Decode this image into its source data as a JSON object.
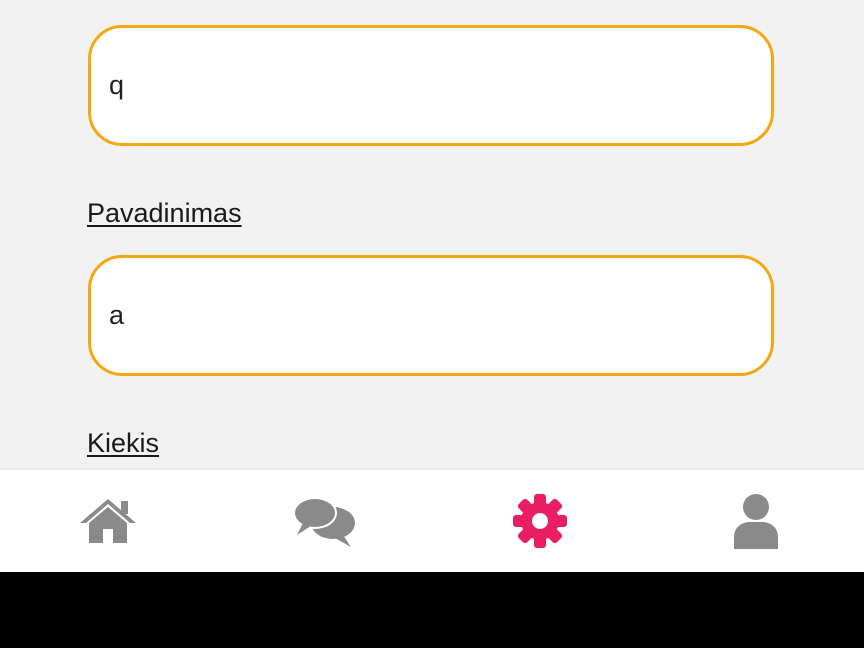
{
  "form": {
    "field1_value": "q",
    "label_name": "Pavadinimas",
    "field2_value": "a",
    "label_quantity": "Kiekis"
  },
  "colors": {
    "accent_border": "#f5a712",
    "active_tab": "#e91e63",
    "inactive_tab": "#8a8a8a"
  },
  "tabbar": {
    "items": [
      {
        "icon": "home-icon",
        "active": false
      },
      {
        "icon": "chat-icon",
        "active": false
      },
      {
        "icon": "gear-icon",
        "active": true
      },
      {
        "icon": "user-icon",
        "active": false
      }
    ]
  }
}
